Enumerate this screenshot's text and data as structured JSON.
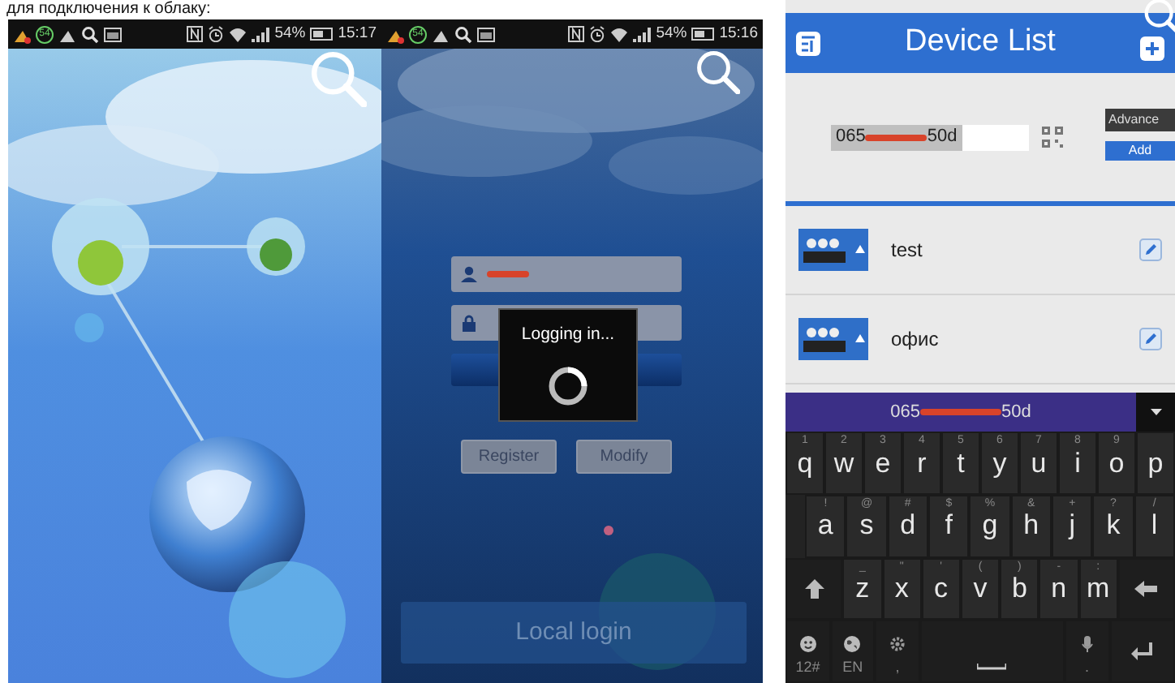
{
  "caption": "для подключения к облаку:",
  "phones": [
    {
      "kind": "splash",
      "status_bar": {
        "badge": "54",
        "battery": "54%",
        "time": "15:17"
      }
    },
    {
      "kind": "login",
      "status_bar": {
        "badge": "54",
        "battery": "54%",
        "time": "15:16"
      },
      "dialog": {
        "title": "Logging in..."
      },
      "buttons": [
        "Register",
        "Modify"
      ],
      "local_login": "Local login"
    }
  ],
  "device_list": {
    "title": "Device List",
    "id_field": {
      "start": "065",
      "end": "50d"
    },
    "advanced": "Advance",
    "add": "Add",
    "devices": [
      {
        "name": "test"
      },
      {
        "name": "офис"
      }
    ],
    "suggestion": {
      "start": "065",
      "end": "50d"
    },
    "keyboard": [
      [
        {
          "kind": "letter",
          "label": "q",
          "hint": "1"
        },
        {
          "kind": "letter",
          "label": "w",
          "hint": "2"
        },
        {
          "kind": "letter",
          "label": "e",
          "hint": "3"
        },
        {
          "kind": "letter",
          "label": "r",
          "hint": "4"
        },
        {
          "kind": "letter",
          "label": "t",
          "hint": "5"
        },
        {
          "kind": "letter",
          "label": "y",
          "hint": "6"
        },
        {
          "kind": "letter",
          "label": "u",
          "hint": "7"
        },
        {
          "kind": "letter",
          "label": "i",
          "hint": "8"
        },
        {
          "kind": "letter",
          "label": "o",
          "hint": "9"
        },
        {
          "kind": "letter",
          "label": "p"
        }
      ],
      [
        {
          "kind": "letter",
          "label": "a",
          "hint": "!"
        },
        {
          "kind": "letter",
          "label": "s",
          "hint": "@"
        },
        {
          "kind": "letter",
          "label": "d",
          "hint": "#"
        },
        {
          "kind": "letter",
          "label": "f",
          "hint": "$"
        },
        {
          "kind": "letter",
          "label": "g",
          "hint": "%"
        },
        {
          "kind": "letter",
          "label": "h",
          "hint": "&"
        },
        {
          "kind": "letter",
          "label": "j",
          "hint": "+"
        },
        {
          "kind": "letter",
          "label": "k",
          "hint": "?"
        },
        {
          "kind": "letter",
          "label": "l",
          "hint": "/"
        }
      ],
      [
        {
          "kind": "shift"
        },
        {
          "kind": "letter",
          "label": "z",
          "hint": "_"
        },
        {
          "kind": "letter",
          "label": "x",
          "hint": "\""
        },
        {
          "kind": "letter",
          "label": "c",
          "hint": "'"
        },
        {
          "kind": "letter",
          "label": "v",
          "hint": "("
        },
        {
          "kind": "letter",
          "label": "b",
          "hint": ")"
        },
        {
          "kind": "letter",
          "label": "n",
          "hint": "-"
        },
        {
          "kind": "letter",
          "label": "m",
          "hint": ":"
        },
        {
          "kind": "backspace"
        }
      ],
      [
        {
          "kind": "emoji",
          "label": "12#"
        },
        {
          "kind": "globe",
          "label": "EN"
        },
        {
          "kind": "gear",
          "label": ","
        },
        {
          "kind": "space"
        },
        {
          "kind": "mic",
          "label": "."
        },
        {
          "kind": "enter"
        }
      ]
    ]
  }
}
